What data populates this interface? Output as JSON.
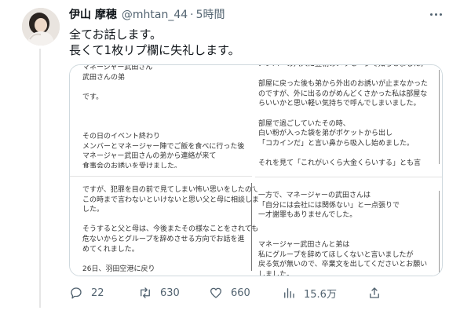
{
  "tweet": {
    "author_name": "伊山 摩穂",
    "author_handle": "@mhtan_44",
    "separator": "·",
    "time": "5時間",
    "text_lines": [
      "全てお話します。",
      "長くて1枚リプ欄に失礼します。"
    ]
  },
  "image_text": {
    "col_a": [
      "マネージャー武田さん",
      "武田さんの弟",
      "",
      "です。",
      "",
      "",
      "",
      "その日のイベント終わり",
      "メンバーとマネージャー陣でご飯を食べに行った後",
      "マネージャー武田さんの弟から連絡が来て",
      "食事会のお誘いを受けました。"
    ],
    "col_b": [
      "ですが、犯罪を目の前で見てしまい怖い思いをしたので",
      "この時まで言わないといけないと思い父と母に相談しま",
      "した。",
      "",
      "そうすると父と母は、今後またその様なことをされても",
      "危ないからとグループを辞めさせる方向でお話を進",
      "めてくれました。",
      "",
      "26日、羽田空港に戻り"
    ],
    "col_c": [
      "メンバーの六人に翌朝のメッセージで知らせました。",
      "",
      "部屋に戻った後も弟から外出のお誘いが止まなかった",
      "のですが、外に出るのがめんどくさかった私は部屋な",
      "らいいかと思い軽い気持ちで呼んでしまいました。",
      "",
      "部屋で過ごしていたその時、",
      "白い粉が入った袋を弟がポケットから出し",
      "「コカインだ」と言い鼻から吸入し始めました。",
      "",
      "それを見て「これがいくら大金くらいする」とも言"
    ],
    "col_d": [
      "一方で、マネージャーの武田さんは",
      "「自分には会社には関係ない」と一点張りで",
      "一才謝罪もありませんでした。",
      "",
      "",
      "マネージャー武田さんと弟は",
      "私にグループを辞めてほしくないと言いましたが",
      "戻る気が無いので、卒業文を出してくださいとお願い",
      "しました。"
    ]
  },
  "actions": {
    "reply_count": "22",
    "retweet_count": "630",
    "like_count": "660",
    "view_count": "15.6万"
  },
  "icons": [
    "more-icon",
    "reply-icon",
    "retweet-icon",
    "like-icon",
    "views-icon",
    "share-icon"
  ],
  "colors": {
    "text": "#0f1419",
    "secondary": "#536471",
    "border": "#cfd9de"
  }
}
